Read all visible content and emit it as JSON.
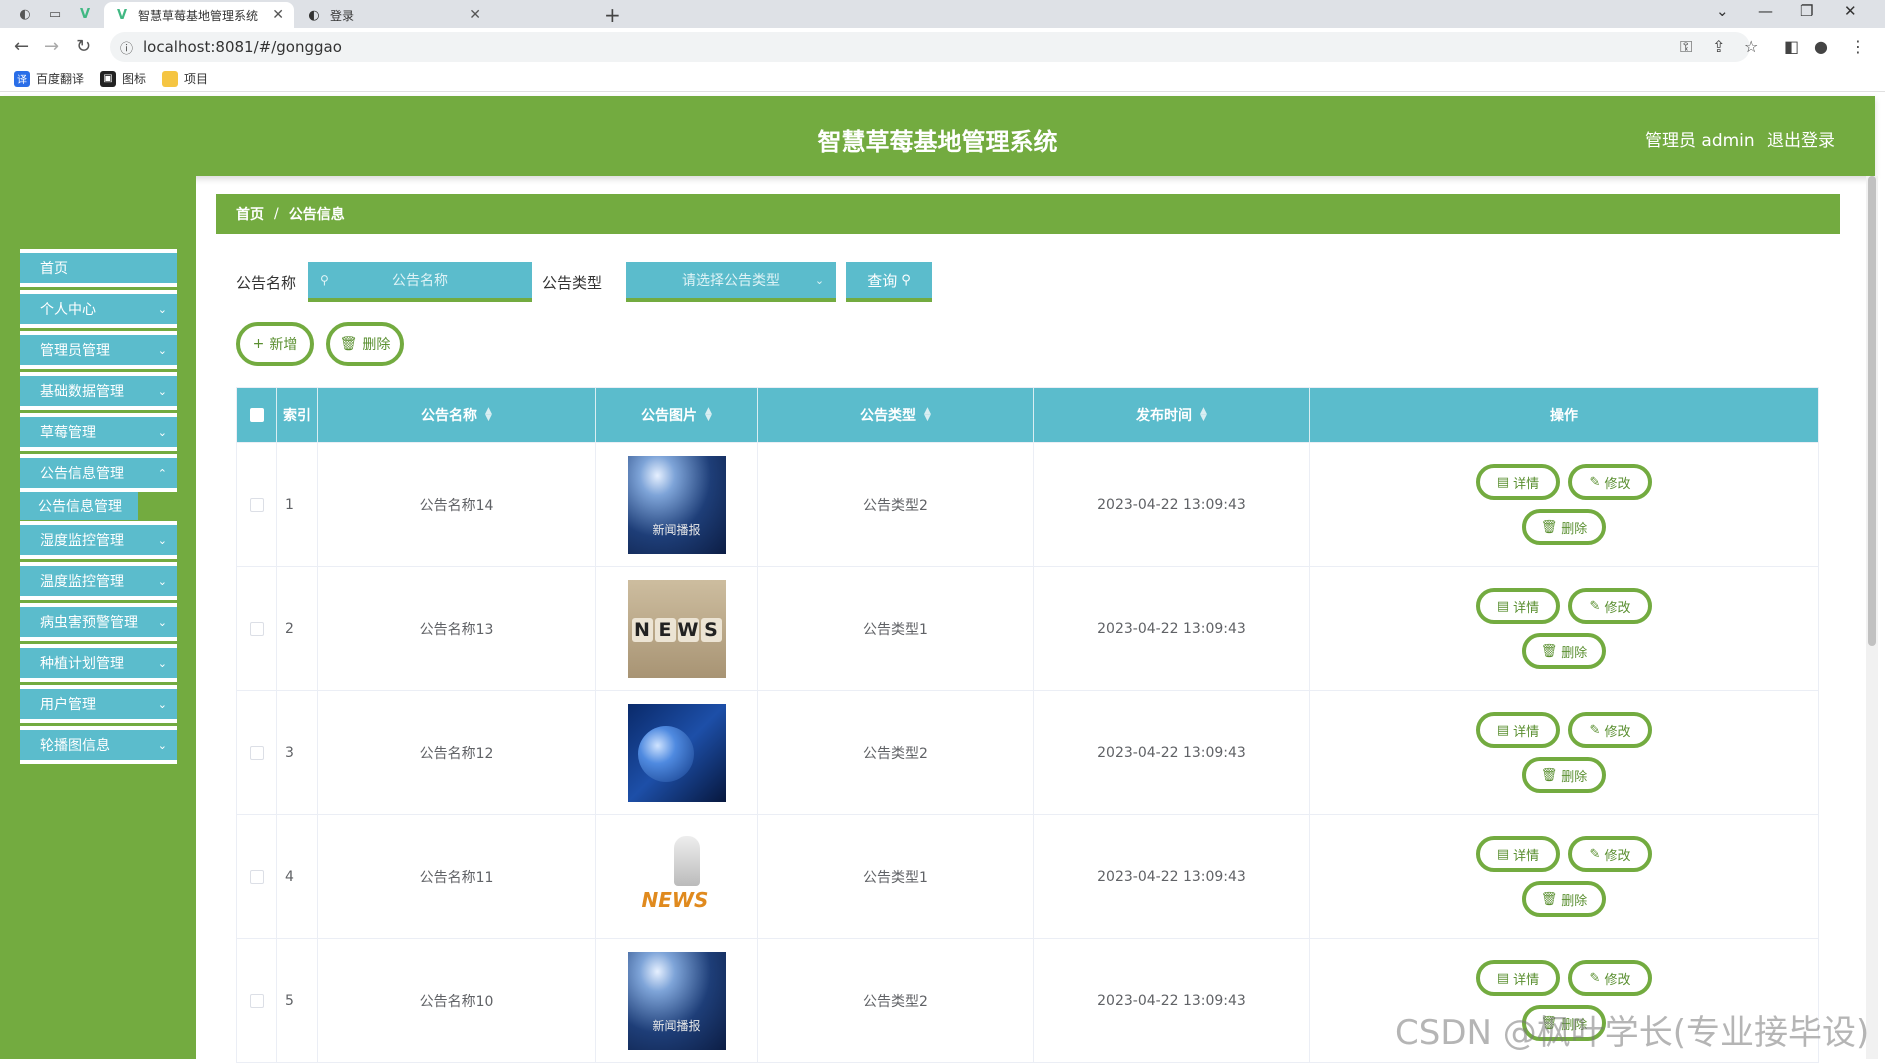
{
  "browser": {
    "tabs": [
      {
        "title": "智慧草莓基地管理系统",
        "icon": "vue-icon",
        "active": true
      },
      {
        "title": "登录",
        "icon": "globe-icon",
        "active": false
      }
    ],
    "url": "localhost:8081/#/gonggao",
    "bookmarks": [
      {
        "label": "百度翻译",
        "icon": "translate-icon"
      },
      {
        "label": "图标",
        "icon": "image-icon"
      },
      {
        "label": "项目",
        "icon": "folder-icon"
      }
    ]
  },
  "header": {
    "title": "智慧草莓基地管理系统",
    "user": "管理员 admin",
    "logout": "退出登录"
  },
  "sidebar": {
    "items": [
      {
        "label": "首页"
      },
      {
        "label": "个人中心"
      },
      {
        "label": "管理员管理"
      },
      {
        "label": "基础数据管理"
      },
      {
        "label": "草莓管理"
      },
      {
        "label": "公告信息管理"
      },
      {
        "label": "湿度监控管理"
      },
      {
        "label": "温度监控管理"
      },
      {
        "label": "病虫害预警管理"
      },
      {
        "label": "种植计划管理"
      },
      {
        "label": "用户管理"
      },
      {
        "label": "轮播图信息"
      }
    ],
    "active_sub": "公告信息管理"
  },
  "breadcrumb": {
    "home": "首页",
    "sep": "/",
    "current": "公告信息"
  },
  "search": {
    "name_label": "公告名称",
    "name_placeholder": "公告名称",
    "type_label": "公告类型",
    "type_placeholder": "请选择公告类型",
    "query": "查询"
  },
  "actions": {
    "add": "新增",
    "delete": "删除"
  },
  "table": {
    "headers": {
      "index": "索引",
      "name": "公告名称",
      "image": "公告图片",
      "type": "公告类型",
      "time": "发布时间",
      "ops": "操作"
    },
    "rows": [
      {
        "index": "1",
        "name": "公告名称14",
        "image": "stage",
        "image_label": "新闻播报",
        "type": "公告类型2",
        "time": "2023-04-22 13:09:43"
      },
      {
        "index": "2",
        "name": "公告名称13",
        "image": "news",
        "image_label": "NEWS",
        "type": "公告类型1",
        "time": "2023-04-22 13:09:43"
      },
      {
        "index": "3",
        "name": "公告名称12",
        "image": "globe",
        "image_label": "",
        "type": "公告类型2",
        "time": "2023-04-22 13:09:43"
      },
      {
        "index": "4",
        "name": "公告名称11",
        "image": "reader",
        "image_label": "NEWS",
        "type": "公告类型1",
        "time": "2023-04-22 13:09:43"
      },
      {
        "index": "5",
        "name": "公告名称10",
        "image": "stage",
        "image_label": "新闻播报",
        "type": "公告类型2",
        "time": "2023-04-22 13:09:43"
      }
    ],
    "row_actions": {
      "detail": "详情",
      "edit": "修改",
      "delete": "删除"
    }
  },
  "watermark": "CSDN @枫叶学长(专业接毕设)",
  "colors": {
    "green": "#73ab40",
    "teal": "#5bbccc"
  }
}
